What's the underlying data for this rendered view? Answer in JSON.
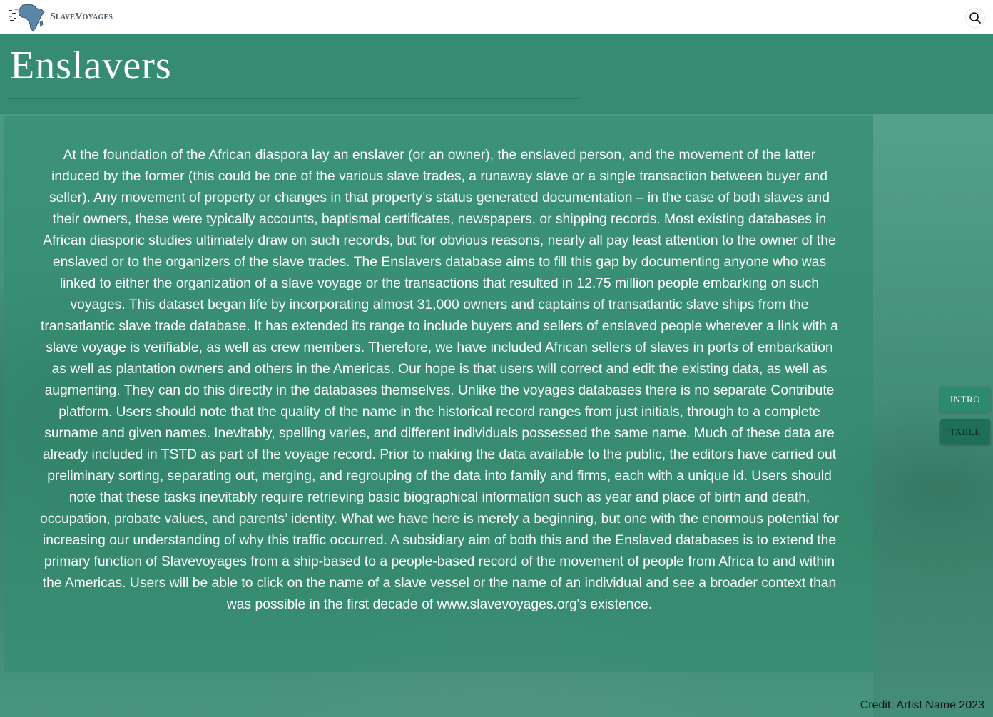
{
  "header": {
    "logo_text": "SlaveVoyages",
    "logo_icon": "africa-map-icon",
    "search_icon": "search-icon"
  },
  "page": {
    "title": "Enslavers"
  },
  "intro": {
    "text": "At the foundation of the African diaspora lay an enslaver (or an owner), the enslaved person, and the movement of the latter induced by the former (this could be one of the various slave trades, a runaway slave or a single transaction between buyer and seller). Any movement of property or changes in that property’s status generated documentation – in the case of both slaves and their owners, these were typically accounts, baptismal certificates, newspapers, or shipping records. Most existing databases in African diasporic studies ultimately draw on such records, but for obvious reasons, nearly all pay least attention to the owner of the enslaved or to the organizers of the slave trades. The Enslavers database aims to fill this gap by documenting anyone who was linked to either the organization of a slave voyage or the transactions that resulted in 12.75 million people embarking on such voyages. This dataset began life by incorporating almost 31,000 owners and captains of transatlantic slave ships from the transatlantic slave trade database. It has extended its range to include buyers and sellers of enslaved people wherever a link with a slave voyage is verifiable, as well as crew members. Therefore, we have included African sellers of slaves in ports of embarkation as well as plantation owners and others in the Americas. Our hope is that users will correct and edit the existing data, as well as augmenting. They can do this directly in the databases themselves. Unlike the voyages databases there is no separate Contribute platform. Users should note that the quality of the name in the historical record ranges from just initials, through to a complete surname and given names. Inevitably, spelling varies, and different individuals possessed the same name. Much of these data are already included in TSTD as part of the voyage record. Prior to making the data available to the public, the editors have carried out preliminary sorting, separating out, merging, and regrouping of the data into family and firms, each with a unique id. Users should note that these tasks inevitably require retrieving basic biographical information such as year and place of birth and death, occupation, probate values, and parents’ identity. What we have here is merely a beginning, but one with the enormous potential for increasing our understanding of why this traffic occurred. A subsidiary aim of both this and the Enslaved databases is to extend the primary function of Slavevoyages from a ship-based to a people-based record of the movement of people from Africa to and within the Americas. Users will be able to click on the name of a slave vessel or the name of an individual and see a broader context than was possible in the first decade of www.slavevoyages.org's existence."
  },
  "side_nav": {
    "intro_label": "INTRO",
    "table_label": "TABLE"
  },
  "footer": {
    "credit": "Credit: Artist Name 2023"
  },
  "colors": {
    "header_bg": "#ffffff",
    "title_band": "#368c72",
    "panel": "#3e8f77",
    "intro_button": "#2c8a6d",
    "table_button": "#1f6f57",
    "logo_map": "#5b86a8"
  }
}
